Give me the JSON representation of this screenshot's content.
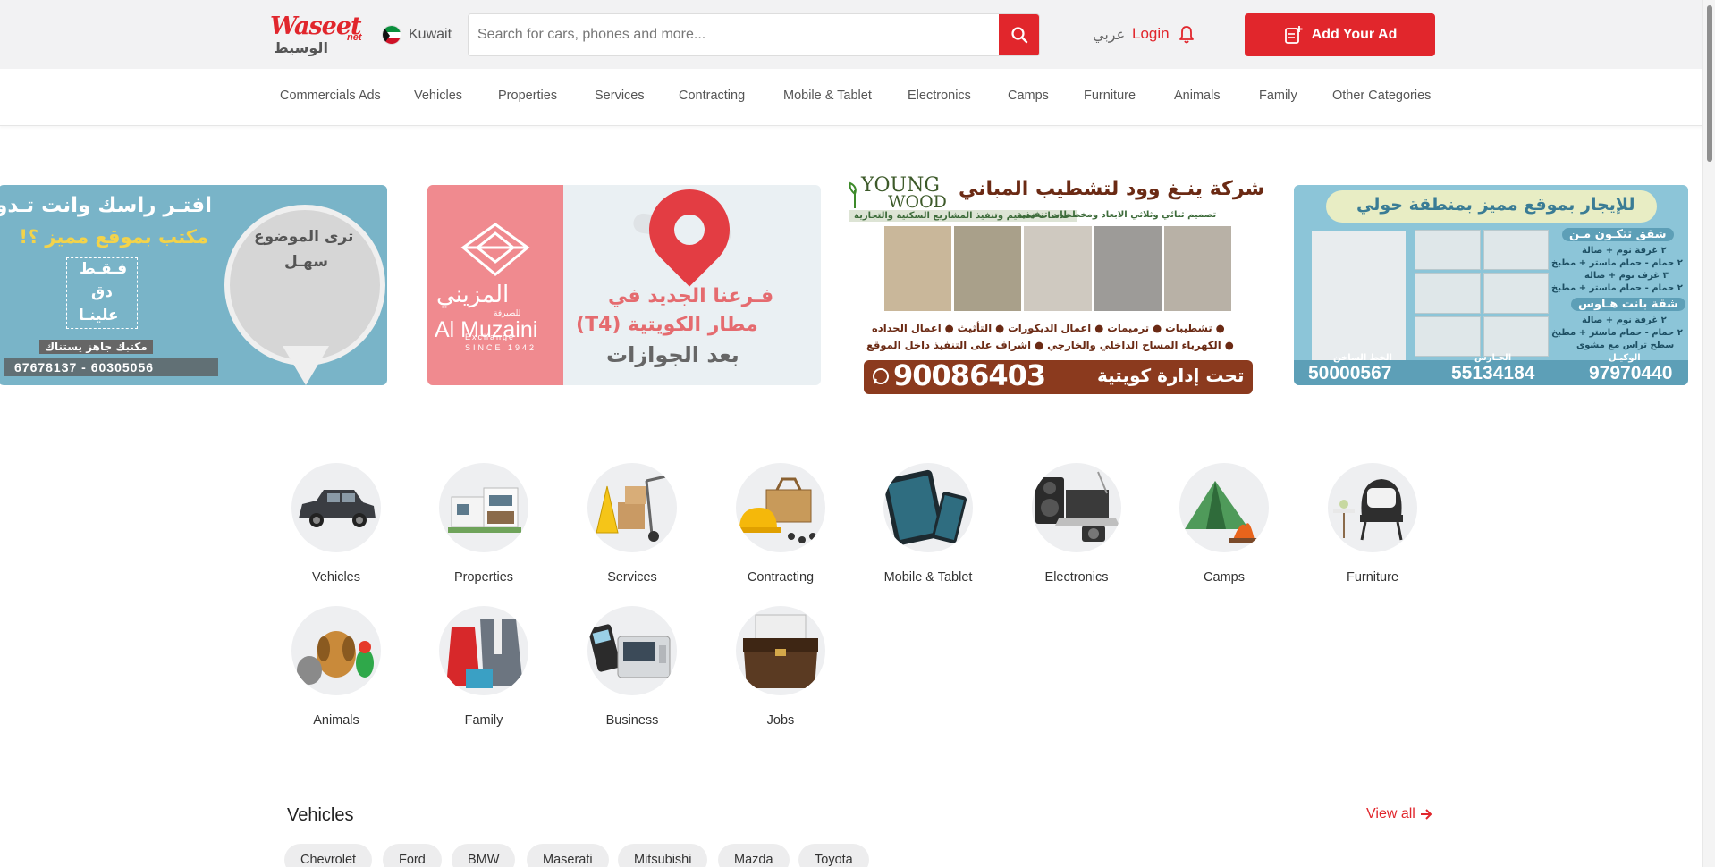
{
  "header": {
    "logo_text": "Waseet",
    "logo_net": "net",
    "logo_arabic": "الوسيط",
    "country": "Kuwait",
    "search_placeholder": "Search for cars, phones and more...",
    "lang_label": "عربي",
    "login_label": "Login",
    "add_ad_label": "Add Your Ad",
    "accent_color": "#e1262c"
  },
  "nav": {
    "items": [
      "Commercials Ads",
      "Vehicles",
      "Properties",
      "Services",
      "Contracting",
      "Mobile & Tablet",
      "Electronics",
      "Camps",
      "Furniture",
      "Animals",
      "Family",
      "Other Categories"
    ]
  },
  "banners": [
    {
      "name": "office-ad",
      "line1": "افتـر راسك وانت تـدور",
      "line2": "مكتب بموقع مميز ؟!",
      "circle_l1": "ترى الموضوع",
      "circle_l2": "سهـل",
      "box_l1": "فـقـط",
      "box_l2": "دق",
      "box_l3": "علينـا",
      "tag": "مكتبك جاهز يستناك",
      "phones": "67678137 - 60305056"
    },
    {
      "name": "al-muzaini",
      "brand_ar": "المزيني",
      "brand_sub_ar": "للصيرفة",
      "brand_en": "Al Muzaini",
      "brand_sub_en": "Exchange",
      "since": "SINCE 1942",
      "line1": "فـرعنا الجديد في",
      "line2": "مطار الكويتية (T4)",
      "line3": "بعد الجوازات"
    },
    {
      "name": "young-wood",
      "brand1": "YOUNG",
      "brand2": "WOOD",
      "title": "شركة ينـغ وود لتشطيب المباني",
      "sub1": "خدمـات تصميم وتنفيذ المشاريع السكنية والتجارية",
      "sub2": "تصميم ثنائي وثلاثي الابعاد ومخططات تنفيذية",
      "svc1": "● تشطيبات ● ترميمات ● اعمال الديكورات ● التأثيث ● اعمال الحداده",
      "svc2": "● الكهرباء   المساح الداخلي والخارجي ● اشراف على التنفيذ داخل الموقع",
      "phone": "90086403",
      "mgmt": "تحت إدارة كويتية"
    },
    {
      "name": "hawalli-rent",
      "title": "للإيجار بموقع مميز بمنطقة حولي",
      "h1": "شقق تتكـون مـن",
      "l1": "٢ غرفة نوم + صالة",
      "l2": "٢ حمام - حمام ماستر + مطبخ",
      "l3": "٣ غرف نوم + صالة",
      "l4": "٢ حمام - حمام ماستر + مطبخ",
      "h2": "شقة بانت هـاوس",
      "l5": "٢ غرفة نوم + صالة",
      "l6": "٢ حمام - حمام ماستر + مطبخ",
      "l7": "سطح تراس مع مشوى",
      "hot_label": "الخط الساخن",
      "guard_label": "الحـارس",
      "agent_label": "الوكيـل",
      "hot": "50000567",
      "guard": "55134184",
      "agent": "97970440"
    }
  ],
  "categories": [
    "Vehicles",
    "Properties",
    "Services",
    "Contracting",
    "Mobile & Tablet",
    "Electronics",
    "Camps",
    "Furniture",
    "Animals",
    "Family",
    "Business",
    "Jobs"
  ],
  "vehicles_section": {
    "title": "Vehicles",
    "view_all": "View all",
    "brands": [
      "Chevrolet",
      "Ford",
      "BMW",
      "Maserati",
      "Mitsubishi",
      "Mazda",
      "Toyota"
    ]
  }
}
